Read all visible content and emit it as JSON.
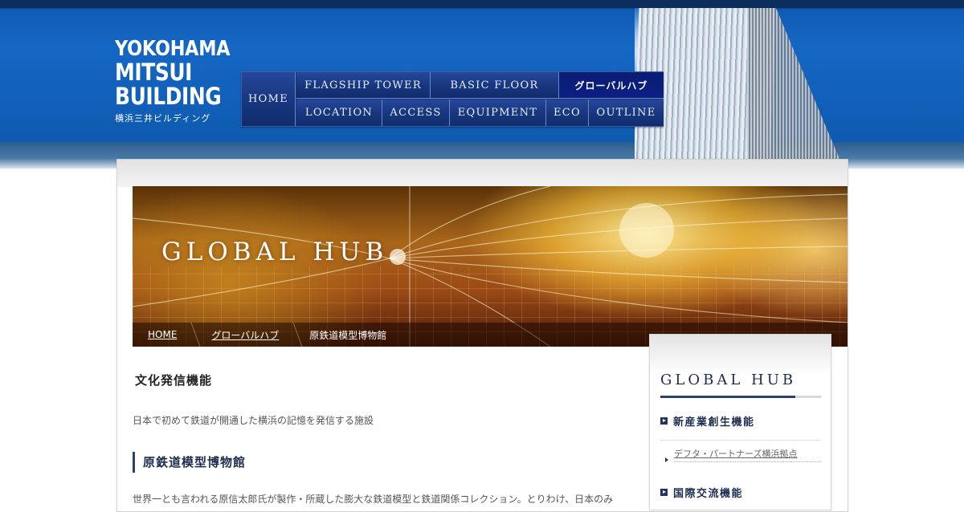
{
  "logo": {
    "line1": "YOKOHAMA",
    "line2": "MITSUI",
    "line3": "BUILDING",
    "sub": "横浜三井ビルディング"
  },
  "nav": {
    "home": "HOME",
    "row1": [
      "FLAGSHIP TOWER",
      "BASIC FLOOR",
      "グローバルハブ"
    ],
    "row2": [
      "LOCATION",
      "ACCESS",
      "EQUIPMENT",
      "ECO",
      "OUTLINE"
    ],
    "active": "グローバルハブ"
  },
  "hero": {
    "title": "GLOBAL HUB"
  },
  "breadcrumb": {
    "home": "HOME",
    "parent": "グローバルハブ",
    "current": "原鉄道模型博物館"
  },
  "content": {
    "section_heading": "文化発信機能",
    "lead": "日本で初めて鉄道が開通した横浜の記憶を発信する施設",
    "museum_heading": "原鉄道模型博物館",
    "body": "世界一とも言われる原信太郎氏が製作・所蔵した膨大な鉄道模型と鉄道関係コレクション。とりわけ、日本のみ"
  },
  "sidebar": {
    "title": "GLOBAL HUB",
    "categories": [
      "新産業創生機能",
      "国際交流機能"
    ],
    "link": "デフタ・パートナーズ横浜拠点"
  },
  "colors": {
    "header_blue": "#1567c4",
    "nav_navy": "#17367e",
    "nav_active": "#0c1f82",
    "accent_navy": "#1e2d4f"
  }
}
